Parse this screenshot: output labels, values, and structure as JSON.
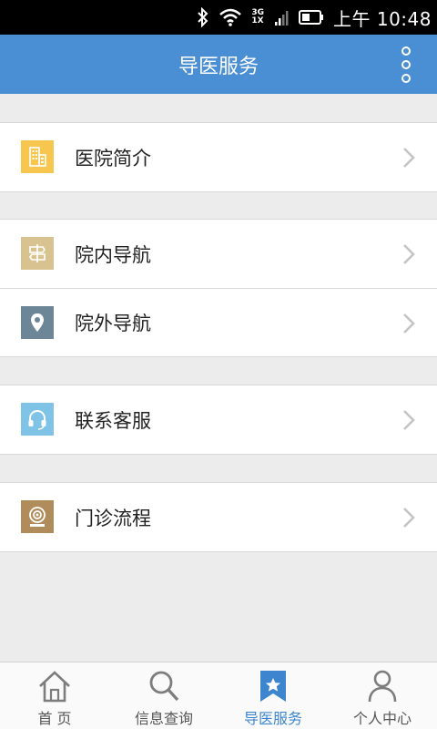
{
  "status_bar": {
    "network_top": "3G",
    "network_bottom": "1X",
    "time": "上午 10:48"
  },
  "app_bar": {
    "title": "导医服务",
    "menu_icon": "more-vertical-icon"
  },
  "groups": [
    {
      "items": [
        {
          "label": "医院简介",
          "icon": "hospital-building-icon",
          "color": "#f6c64f"
        }
      ]
    },
    {
      "items": [
        {
          "label": "院内导航",
          "icon": "signpost-icon",
          "color": "#d8c28f"
        },
        {
          "label": "院外导航",
          "icon": "map-pin-icon",
          "color": "#6c8597"
        }
      ]
    },
    {
      "items": [
        {
          "label": "联系客服",
          "icon": "headset-icon",
          "color": "#7fc3e6"
        }
      ]
    },
    {
      "items": [
        {
          "label": "门诊流程",
          "icon": "webcam-icon",
          "color": "#b08c5a"
        }
      ]
    }
  ],
  "bottom_nav": {
    "tabs": [
      {
        "label": "首 页",
        "icon": "home-icon",
        "active": false
      },
      {
        "label": "信息查询",
        "icon": "search-icon",
        "active": false
      },
      {
        "label": "导医服务",
        "icon": "bookmark-star-icon",
        "active": true
      },
      {
        "label": "个人中心",
        "icon": "person-icon",
        "active": false
      }
    ]
  },
  "colors": {
    "app_bar": "#4a8fd3",
    "active_tab": "#3d86cf",
    "background": "#ececec"
  }
}
